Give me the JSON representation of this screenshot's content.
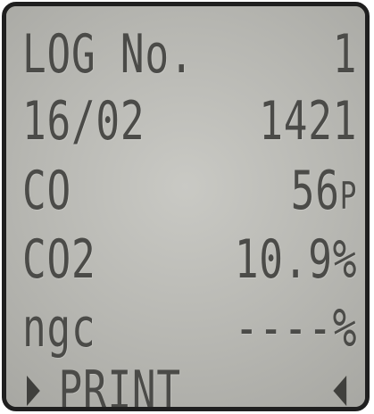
{
  "display": {
    "row1": {
      "left": "LOG No.",
      "right": "1"
    },
    "row2": {
      "left": "16/02",
      "right": "1421"
    },
    "row3": {
      "left": "CO",
      "right_value": "56",
      "right_unit": "P"
    },
    "row4": {
      "left": "CO2",
      "right": "10.9%"
    },
    "row5": {
      "left": "ngc",
      "right": "----%"
    },
    "row6": {
      "label": "PRINT"
    }
  },
  "icons": {
    "left_arrow": "triangle-right-icon",
    "right_arrow": "triangle-left-icon"
  },
  "colors": {
    "screen": "#bcbcb8",
    "text": "#4b4b48",
    "frame": "#1f1f1f"
  }
}
